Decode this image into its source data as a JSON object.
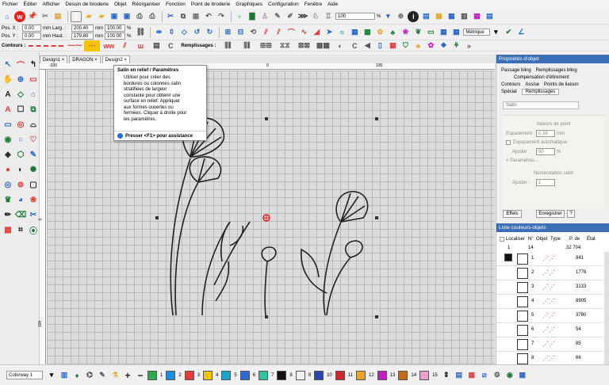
{
  "menu": [
    "Fichier",
    "Éditer",
    "Afficher",
    "Dessin de broderie",
    "Objet",
    "Réorganiser",
    "Fonction",
    "Point de broderie",
    "Graphiques",
    "Configuration",
    "Fenêtre",
    "Aide"
  ],
  "toolbar": {
    "zoom_value": "100",
    "zoom_unit": "%",
    "metric_label": "Métrique",
    "pos_x_label": "Pos. X :",
    "pos_x_value": "0.00",
    "pos_y_label": "Pos. Y :",
    "pos_y_value": "0.00",
    "unit_mm": "mm",
    "width_label": "Larg. :",
    "width_value": "200.40",
    "height_label": "Haut. :",
    "height_value": "179.80",
    "scale_w": "100.00",
    "scale_h": "100.00",
    "percent": "%",
    "contours_label": "Contours :",
    "fills_label": "Remplissages :"
  },
  "doc_tabs": [
    {
      "label": "Design1",
      "close": "×"
    },
    {
      "label": "DRAGON",
      "close": "×"
    },
    {
      "label": "Design2",
      "close": "×"
    }
  ],
  "ruler": {
    "t200": "-200",
    "t0": "0",
    "t100": "100",
    "l0": "0",
    "l100": "100"
  },
  "tooltip": {
    "title": "Satin en relief / Paramètres",
    "body": [
      "Utiliser pour créer des",
      "bordures ou colonnes satin",
      "stratifiées de largeur",
      "constante pour obtenir une",
      "surface en relief. Appliquer",
      "aux formes ouvertes ou",
      "fermées. Cliquer à droite pour",
      "les paramètres."
    ],
    "help": "Presser <F1> pour assistance"
  },
  "object_props": {
    "title": "Propriétés d'objet",
    "tabs_row1": [
      "Passage bling",
      "Remplissages bling"
    ],
    "tab_comp": "Compensation d'étirement",
    "tabs_row2": [
      "Contours",
      "Assise",
      "Points de liaison"
    ],
    "tabs_row3": [
      "Spécial",
      "Remplissages"
    ],
    "stitch_type": "Satin",
    "section_stitch": "Valeurs de point",
    "spacing_label": "Espacement :",
    "spacing_value": "0.38",
    "spacing_unit": "mm",
    "auto_spacing": "Espacement automatique",
    "width_label": "Ajuster :",
    "width_value": "90",
    "width_unit": "%",
    "params_label": "< Paramètres...",
    "satin_split": "Numérotation satin",
    "split_label": "Ajuster :",
    "split_value": "1",
    "effects": "Effets",
    "save": "Enregistrer",
    "help_btn": "?"
  },
  "colorlist": {
    "title": "Liste couleurs-objets",
    "locate": "Localiser",
    "cols": [
      "N°",
      "Objet",
      "Type",
      "P. de",
      "État"
    ],
    "group_num": "1",
    "group_count": "14",
    "group_total": "32 704",
    "rows": [
      {
        "n": "1",
        "pts": "841"
      },
      {
        "n": "2",
        "pts": "1776"
      },
      {
        "n": "3",
        "pts": "3133"
      },
      {
        "n": "4",
        "pts": "8905"
      },
      {
        "n": "5",
        "pts": "3780"
      },
      {
        "n": "6",
        "pts": "54"
      },
      {
        "n": "7",
        "pts": "85"
      },
      {
        "n": "8",
        "pts": "66"
      }
    ]
  },
  "status": {
    "colorway": "Colorway 1",
    "swatches": [
      {
        "n": "1",
        "color": "#2fa84f"
      },
      {
        "n": "2",
        "color": "#1e8fe0"
      },
      {
        "n": "3",
        "color": "#e43b3b"
      },
      {
        "n": "4",
        "color": "#f5c400"
      },
      {
        "n": "5",
        "color": "#17a8c9"
      },
      {
        "n": "6",
        "color": "#2d6ad9"
      },
      {
        "n": "7",
        "color": "#2ec4a0"
      },
      {
        "n": "8",
        "color": "#111111"
      },
      {
        "n": "9",
        "color": "#f0f0f0"
      },
      {
        "n": "10",
        "color": "#2546b0"
      },
      {
        "n": "11",
        "color": "#d2262f"
      },
      {
        "n": "12",
        "color": "#e8a530"
      },
      {
        "n": "13",
        "color": "#c11fc1"
      },
      {
        "n": "14",
        "color": "#c66a14"
      },
      {
        "n": "15",
        "color": "#e8a0c8"
      }
    ]
  },
  "colors": {
    "accent": "#3c6fb5",
    "active_blue": "#2a6ed8"
  }
}
